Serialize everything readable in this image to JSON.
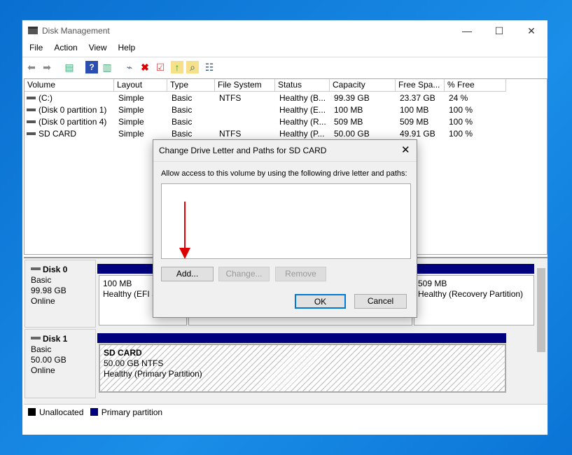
{
  "window": {
    "title": "Disk Management",
    "controls": [
      "—",
      "☐",
      "✕"
    ]
  },
  "menu": [
    "File",
    "Action",
    "View",
    "Help"
  ],
  "toolbar": [
    "back-icon",
    "forward-icon",
    "console-tree-icon",
    "help-icon",
    "action-pane-icon",
    "connect-drive-icon",
    "delete-icon",
    "properties-icon",
    "export-icon",
    "search-icon",
    "checklist-icon"
  ],
  "list": {
    "columns": [
      "Volume",
      "Layout",
      "Type",
      "File System",
      "Status",
      "Capacity",
      "Free Spa...",
      "% Free"
    ],
    "rows": [
      [
        "(C:)",
        "Simple",
        "Basic",
        "NTFS",
        "Healthy (B...",
        "99.39 GB",
        "23.37 GB",
        "24 %"
      ],
      [
        "(Disk 0 partition 1)",
        "Simple",
        "Basic",
        "",
        "Healthy (E...",
        "100 MB",
        "100 MB",
        "100 %"
      ],
      [
        "(Disk 0 partition 4)",
        "Simple",
        "Basic",
        "",
        "Healthy (R...",
        "509 MB",
        "509 MB",
        "100 %"
      ],
      [
        "SD CARD",
        "Simple",
        "Basic",
        "NTFS",
        "Healthy (P...",
        "50.00 GB",
        "49.91 GB",
        "100 %"
      ]
    ]
  },
  "disks": [
    {
      "name": "Disk 0",
      "type": "Basic",
      "size": "99.98 GB",
      "status": "Online",
      "parts": [
        {
          "l1": "100 MB",
          "l2": "Healthy (EFI System Partition)"
        },
        {
          "l1": "",
          "l2": ""
        },
        {
          "l1": "509 MB",
          "l2": "Healthy (Recovery Partition)"
        }
      ]
    },
    {
      "name": "Disk 1",
      "type": "Basic",
      "size": "50.00 GB",
      "status": "Online",
      "parts": [
        {
          "l0": "SD CARD",
          "l1": "50.00 GB NTFS",
          "l2": "Healthy (Primary Partition)"
        }
      ]
    }
  ],
  "legend": [
    {
      "label": "Unallocated",
      "color": "#000000"
    },
    {
      "label": "Primary partition",
      "color": "#00007f"
    }
  ],
  "dialog": {
    "title": "Change Drive Letter and Paths for SD CARD",
    "prompt": "Allow access to this volume by using the following drive letter and paths:",
    "add": "Add...",
    "change": "Change...",
    "remove": "Remove",
    "ok": "OK",
    "cancel": "Cancel",
    "close": "✕"
  }
}
